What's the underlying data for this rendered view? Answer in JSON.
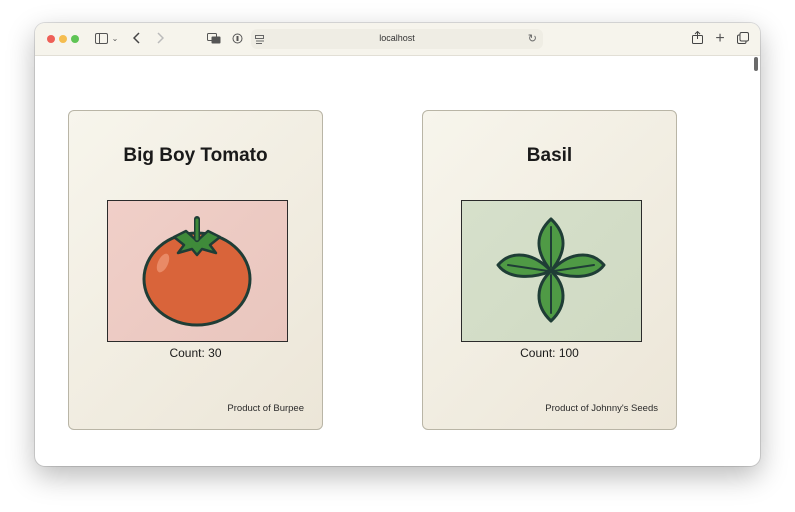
{
  "browser": {
    "url": "localhost"
  },
  "products": [
    {
      "title": "Big Boy Tomato",
      "count_text": "Count: 30",
      "footer_text": "Product of Burpee",
      "image_bg": "#eecdc6",
      "icon": "tomato-icon"
    },
    {
      "title": "Basil",
      "count_text": "Count: 100",
      "footer_text": "Product of Johnny's Seeds",
      "image_bg": "#d4dec8",
      "icon": "basil-icon"
    }
  ],
  "colors": {
    "tomato": "#d9643a",
    "tomato_outline": "#1f3d36",
    "leaf_green": "#3f8a3a",
    "basil_green": "#4f9a45"
  }
}
